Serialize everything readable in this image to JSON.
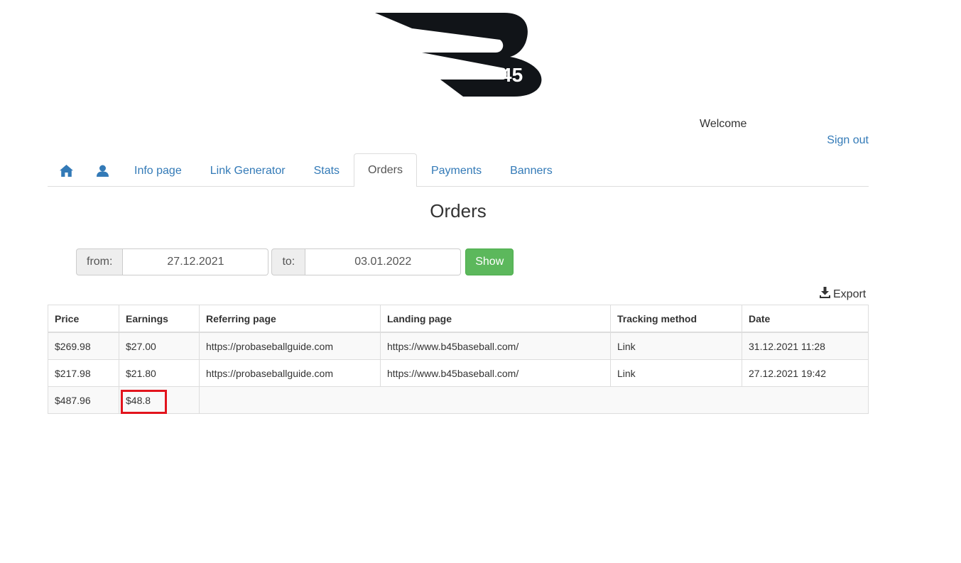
{
  "header": {
    "logo_text": "45",
    "welcome": "Welcome",
    "sign_out": "Sign out"
  },
  "tabs": [
    {
      "label": "",
      "icon": "home-icon",
      "active": false
    },
    {
      "label": "",
      "icon": "user-icon",
      "active": false
    },
    {
      "label": "Info page",
      "active": false
    },
    {
      "label": "Link Generator",
      "active": false
    },
    {
      "label": "Stats",
      "active": false
    },
    {
      "label": "Orders",
      "active": true
    },
    {
      "label": "Payments",
      "active": false
    },
    {
      "label": "Banners",
      "active": false
    }
  ],
  "page_title": "Orders",
  "filter": {
    "from_label": "from:",
    "from_value": "27.12.2021",
    "to_label": "to:",
    "to_value": "03.01.2022",
    "show_label": "Show"
  },
  "export_label": "Export",
  "table": {
    "headers": [
      "Price",
      "Earnings",
      "Referring page",
      "Landing page",
      "Tracking method",
      "Date"
    ],
    "rows": [
      [
        "$269.98",
        "$27.00",
        "https://probaseballguide.com",
        "https://www.b45baseball.com/",
        "Link",
        "31.12.2021 11:28"
      ],
      [
        "$217.98",
        "$21.80",
        "https://probaseballguide.com",
        "https://www.b45baseball.com/",
        "Link",
        "27.12.2021 19:42"
      ]
    ],
    "totals": {
      "price": "$487.96",
      "earnings": "$48.8"
    }
  },
  "colors": {
    "link": "#337ab7",
    "show_button": "#5cb85c",
    "highlight": "#e2141d",
    "logo": "#111418"
  }
}
